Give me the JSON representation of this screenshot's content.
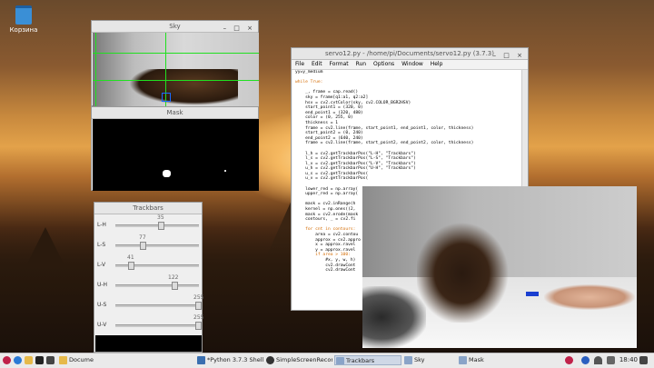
{
  "desktop": {
    "trash_label": "Корзина"
  },
  "sky_window": {
    "title": "Sky"
  },
  "mask_window": {
    "title": "Mask"
  },
  "trackbars_window": {
    "title": "Trackbars",
    "sliders": [
      {
        "label": "L-H",
        "value": "35",
        "fraction": 0.2
      },
      {
        "label": "L-S",
        "value": "77",
        "fraction": 0.3
      },
      {
        "label": "L-V",
        "value": "41",
        "fraction": 0.16
      },
      {
        "label": "U-H",
        "value": "122",
        "fraction": 0.68
      },
      {
        "label": "U-S",
        "value": "255",
        "fraction": 1.0
      },
      {
        "label": "U-V",
        "value": "255",
        "fraction": 1.0
      }
    ]
  },
  "editor_window": {
    "title": "servo12.py - /home/pi/Documents/servo12.py (3.7.3)",
    "menu": [
      "File",
      "Edit",
      "Format",
      "Run",
      "Options",
      "Window",
      "Help"
    ],
    "code_lines": [
      "yy=y_medium",
      "",
      "while True:",
      "",
      "    _, frame = cap.read()",
      "    sky = frame[q1:a1, q2:a2]",
      "    hsv = cv2.cvtColor(sky, cv2.COLOR_BGR2HSV)",
      "    start_point1 = (320, 0)",
      "    end_point1 = (320, 480)",
      "    color = (0, 255, 0)",
      "    thickness = 1",
      "    frame = cv2.line(frame, start_point1, end_point1, color, thickness)",
      "    start_point2 = (0, 240)",
      "    end_point2 = (640, 240)",
      "    frame = cv2.line(frame, start_point2, end_point2, color, thickness)",
      "",
      "    l_h = cv2.getTrackbarPos(\"L-H\", \"Trackbars\")",
      "    l_s = cv2.getTrackbarPos(\"L-S\", \"Trackbars\")",
      "    l_v = cv2.getTrackbarPos(\"L-V\", \"Trackbars\")",
      "    u_h = cv2.getTrackbarPos(\"U-H\", \"Trackbars\")",
      "    u_s = cv2.getTrackbarPos(",
      "    u_v = cv2.getTrackbarPos(",
      "",
      "    lower_red = np.array(",
      "    upper_red = np.array(",
      "",
      "    mask = cv2.inRange(h",
      "    kernel = np.ones((2,",
      "    mask = cv2.erode(mask",
      "    contours, _ = cv2.fi",
      "",
      "    for cnt in contours:",
      "        area = cv2.contou",
      "        approx = cv2.appro",
      "        x = approx.ravel",
      "        y = approx.ravel",
      "        if area > 100:",
      "            #x, y, w, h)",
      "            cv2.drawCont",
      "            cv2.drawCont"
    ]
  },
  "taskbar": {
    "items": [
      {
        "label": "Docume"
      },
      {
        "label": "*Python 3.7.3 Shell*"
      },
      {
        "label": "SimpleScreenRecord"
      },
      {
        "label": "Trackbars"
      },
      {
        "label": "Sky"
      },
      {
        "label": "Mask"
      }
    ],
    "clock": "18:40"
  }
}
